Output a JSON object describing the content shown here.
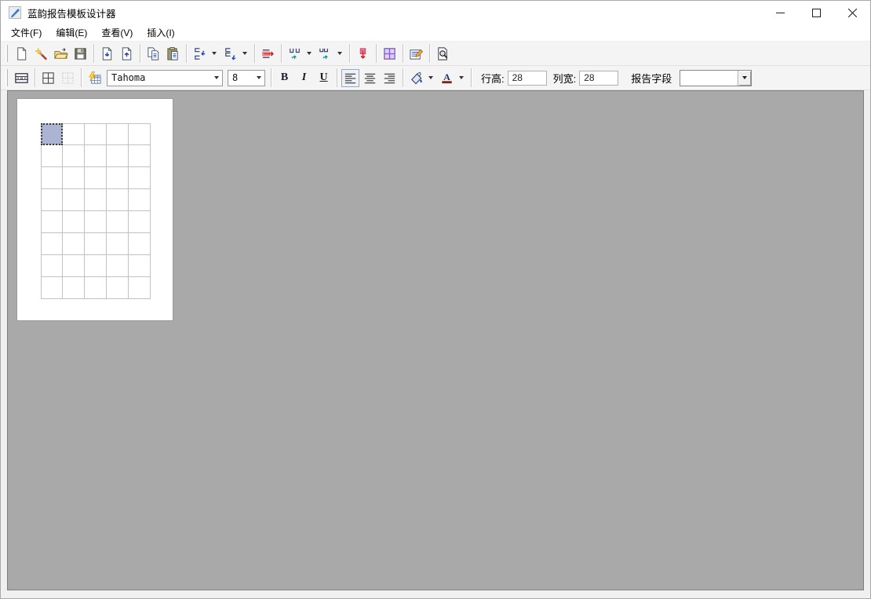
{
  "window": {
    "title": "蓝韵报告模板设计器",
    "controls": {
      "minimize": "minimize",
      "maximize": "maximize",
      "close": "close"
    }
  },
  "menu_bar": {
    "items": [
      {
        "label": "文件(F)"
      },
      {
        "label": "编辑(E)"
      },
      {
        "label": "查看(V)"
      },
      {
        "label": "插入(I)"
      }
    ]
  },
  "toolbar_main": {
    "buttons": [
      {
        "icon": "new-document-icon"
      },
      {
        "icon": "magic-wand-icon"
      },
      {
        "icon": "open-folder-icon"
      },
      {
        "icon": "save-icon"
      },
      {
        "icon": "page-arrow-in-icon"
      },
      {
        "icon": "page-arrow-out-icon"
      },
      {
        "icon": "copy-icon"
      },
      {
        "icon": "paste-icon"
      },
      {
        "icon": "insert-row-before-icon",
        "has_dropdown": true
      },
      {
        "icon": "insert-row-after-icon",
        "has_dropdown": true
      },
      {
        "icon": "delete-row-icon"
      },
      {
        "icon": "insert-column-before-icon",
        "has_dropdown": true
      },
      {
        "icon": "insert-column-after-icon",
        "has_dropdown": true
      },
      {
        "icon": "delete-column-icon"
      },
      {
        "icon": "table-grid-icon"
      },
      {
        "icon": "properties-icon"
      },
      {
        "icon": "print-preview-icon"
      }
    ]
  },
  "toolbar_format": {
    "cell_text_icon": "cell-text-icon",
    "borders_icon": "grid-borders-icon",
    "dotted_grid_icon": "dotted-grid-icon",
    "format_grid_icon": "format-grid-icon",
    "font_name": "Tahoma",
    "font_size": "8",
    "bold_label": "B",
    "italic_label": "I",
    "underline_label": "U",
    "fill_color_icon": "fill-color-icon",
    "font_color_icon": "font-color-icon",
    "row_height_label": "行高:",
    "row_height_value": "28",
    "col_width_label": "列宽:",
    "col_width_value": "28",
    "report_field_label": "报告字段",
    "report_field_value": ""
  },
  "canvas": {
    "grid": {
      "rows": 8,
      "cols": 5,
      "cell_size": 28,
      "selected_row": 0,
      "selected_col": 0,
      "selected_fill": "#abb5d3",
      "line_color": "#c2c2c2"
    }
  },
  "colors": {
    "titlebar_bg": "#ffffff",
    "toolbar_bg": "#f4f4f4",
    "canvas_bg": "#a9a9a9",
    "page_bg": "#ffffff",
    "selected_cell": "#abb5d3",
    "font_color_underline": "#8b1a1a",
    "table_grid_purple": "#8a5ad0"
  }
}
